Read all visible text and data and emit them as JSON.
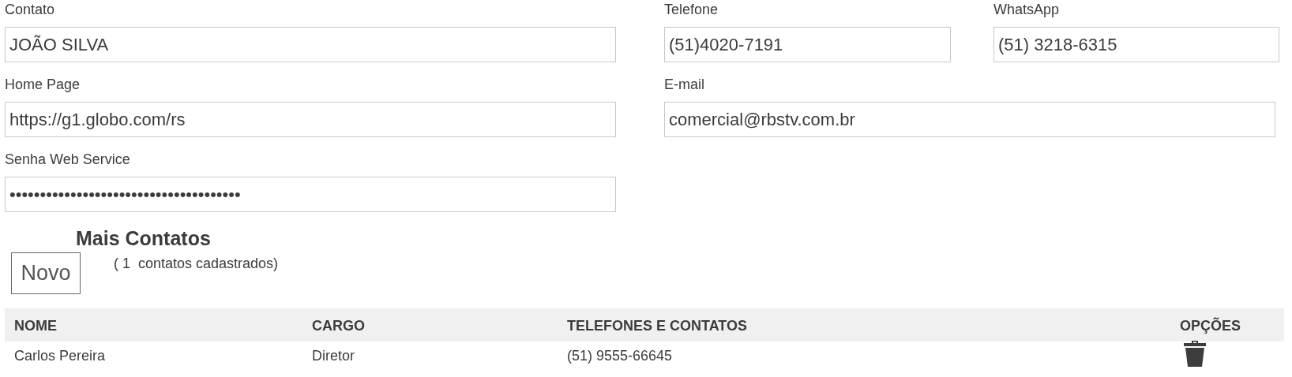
{
  "form": {
    "fields": [
      {
        "label": "Contato",
        "value": "JOÃO SILVA"
      },
      {
        "label": "Telefone",
        "value": "(51)4020-7191"
      },
      {
        "label": "WhatsApp",
        "value": "(51) 3218-6315"
      },
      {
        "label": "Home Page",
        "value": "https://g1.globo.com/rs"
      },
      {
        "label": "E-mail",
        "value": "comercial@rbstv.com.br"
      },
      {
        "label": "Senha Web Service",
        "value": "••••••••••••••••••••••••••••••••••••••"
      }
    ]
  },
  "more_contacts": {
    "title": "Mais Contatos",
    "new_button": "Novo",
    "count_text": "( 1  contatos cadastrados)"
  },
  "table": {
    "columns": [
      "NOME",
      "CARGO",
      "TELEFONES E CONTATOS",
      "OPÇÕES"
    ],
    "rows": [
      {
        "cells": [
          "Carlos Pereira",
          "Diretor",
          "(51) 9555-66645"
        ]
      }
    ]
  }
}
